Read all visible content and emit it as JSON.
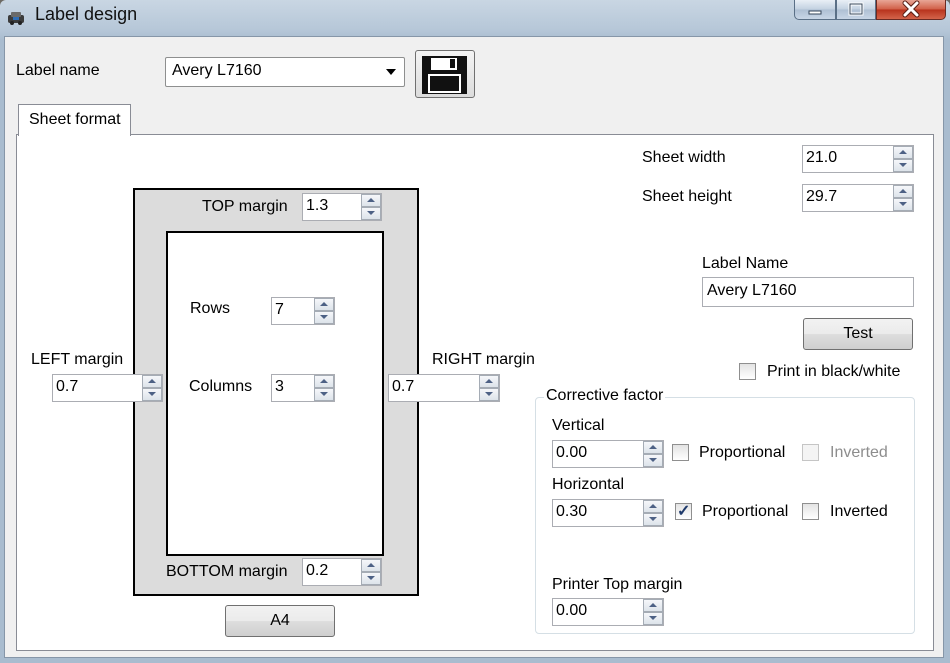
{
  "window": {
    "title": "Label design"
  },
  "header": {
    "label_name_caption": "Label name",
    "label_name_value": "Avery L7160"
  },
  "tabs": [
    {
      "label": "Sheet format",
      "selected": true
    }
  ],
  "sheet": {
    "width_label": "Sheet width",
    "width_value": "21.0",
    "height_label": "Sheet height",
    "height_value": "29.7",
    "top_margin_label": "TOP margin",
    "top_margin_value": "1.3",
    "left_margin_label": "LEFT margin",
    "left_margin_value": "0.7",
    "right_margin_label": "RIGHT margin",
    "right_margin_value": "0.7",
    "bottom_margin_label": "BOTTOM margin",
    "bottom_margin_value": "0.2",
    "rows_label": "Rows",
    "rows_value": "7",
    "columns_label": "Columns",
    "columns_value": "3",
    "paper_button": "A4"
  },
  "label": {
    "name_caption": "Label Name",
    "name_value": "Avery L7160",
    "test_button": "Test",
    "print_bw_label": "Print in black/white",
    "print_bw_checked": false
  },
  "corrective": {
    "title": "Corrective factor",
    "vertical_label": "Vertical",
    "vertical_value": "0.00",
    "vertical_proportional_label": "Proportional",
    "vertical_proportional_checked": false,
    "vertical_inverted_label": "Inverted",
    "vertical_inverted_checked": false,
    "horizontal_label": "Horizontal",
    "horizontal_value": "0.30",
    "horizontal_proportional_label": "Proportional",
    "horizontal_proportional_checked": true,
    "horizontal_inverted_label": "Inverted",
    "horizontal_inverted_checked": false,
    "printer_top_margin_label": "Printer Top margin",
    "printer_top_margin_value": "0.00"
  },
  "icons": {
    "app": "app-icon",
    "save": "floppy-disk-icon",
    "minimize": "minimize-icon",
    "maximize": "maximize-icon",
    "close": "close-icon"
  },
  "colors": {
    "title_bar": "#b6c7d8",
    "close_button": "#c8402a",
    "window_bg": "#f0f0f0",
    "sheet_margin_area": "#dcdcdc",
    "check_mark": "#1f3a6b"
  }
}
